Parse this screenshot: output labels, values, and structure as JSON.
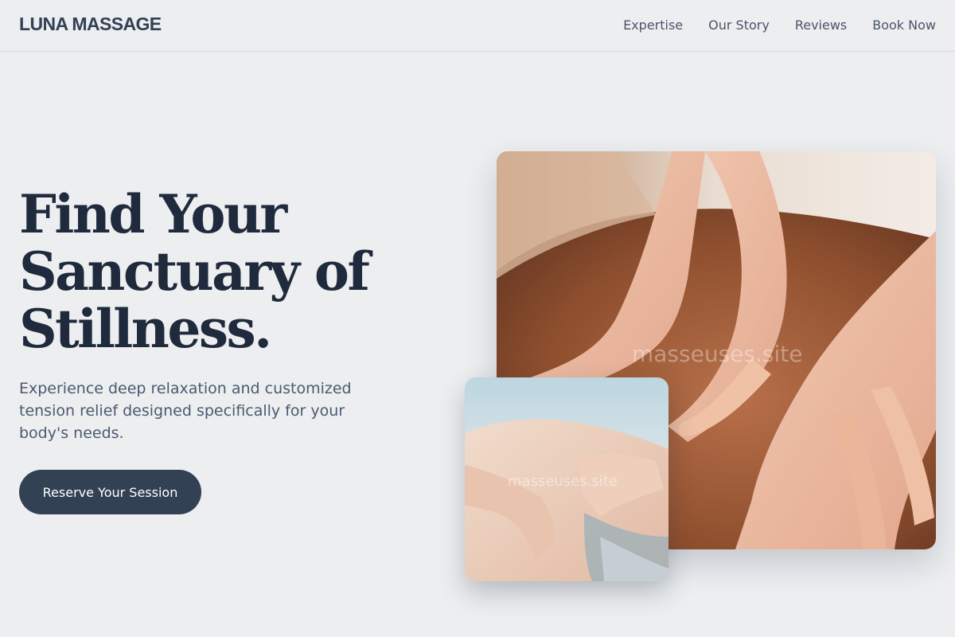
{
  "header": {
    "logo": "LUNA MASSAGE",
    "nav": [
      "Expertise",
      "Our Story",
      "Reviews",
      "Book Now"
    ]
  },
  "hero": {
    "headline_lines": [
      "Find Your",
      "Sanctuary of",
      "Stillness."
    ],
    "subtext": "Experience deep relaxation and customized tension relief designed specifically for your body's needs.",
    "cta_label": "Reserve Your Session"
  },
  "images": {
    "main_watermark": "masseuses.site",
    "small_watermark": "masseuses.site"
  },
  "colors": {
    "background": "#eceef0",
    "heading": "#1f2a3d",
    "button": "#334155",
    "body_text": "#4b5a70"
  }
}
